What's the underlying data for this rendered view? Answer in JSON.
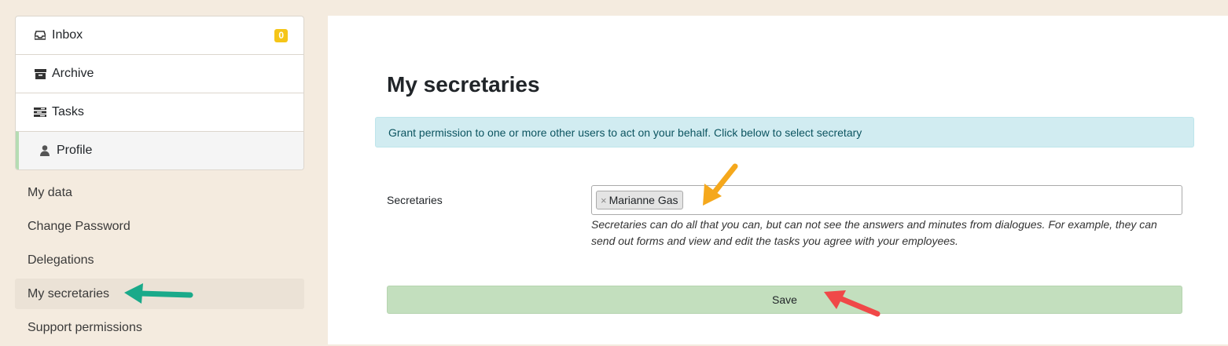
{
  "sidebar": {
    "main_items": [
      {
        "label": "Inbox",
        "icon": "inbox-icon",
        "badge": "0"
      },
      {
        "label": "Archive",
        "icon": "archive-icon"
      },
      {
        "label": "Tasks",
        "icon": "tasks-icon"
      },
      {
        "label": "Profile",
        "icon": "user-icon"
      }
    ],
    "sub_items": [
      {
        "label": "My data"
      },
      {
        "label": "Change Password"
      },
      {
        "label": "Delegations"
      },
      {
        "label": "My secretaries"
      },
      {
        "label": "Support permissions"
      }
    ]
  },
  "main": {
    "title": "My secretaries",
    "info": "Grant permission to one or more other users to act on your behalf. Click below to select secretary",
    "field_label": "Secretaries",
    "selected_tags": [
      {
        "remove": "×",
        "label": "Marianne Gas"
      }
    ],
    "help_text": "Secretaries can do all that you can, but can not see the answers and minutes from dialogues. For example, they can send out forms and view and edit the tasks you agree with your employees.",
    "save_label": "Save"
  },
  "colors": {
    "page_bg": "#f4ebdf",
    "badge": "#f5c518",
    "info_bg": "#d1ecf1",
    "save_bg": "#c3dfbe",
    "arrow_green": "#1aaa8a",
    "arrow_orange": "#f5a81c",
    "arrow_red": "#f04848"
  }
}
